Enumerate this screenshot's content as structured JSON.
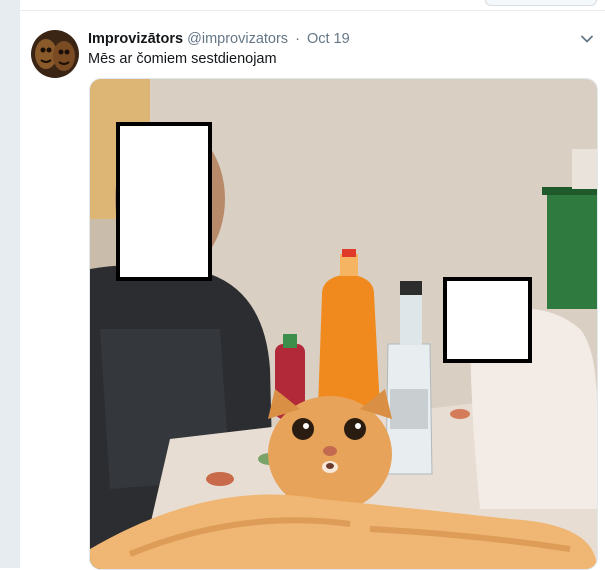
{
  "tweet": {
    "display_name": "Improvizātors",
    "handle": "@improvizators",
    "separator": "·",
    "timestamp": "Oct 19",
    "text": "Mēs ar čomiem sestdienojam"
  },
  "icons": {
    "avatar": "avatar-image",
    "more": "chevron-down-icon"
  },
  "media": {
    "description_icon": "photo"
  },
  "colors": {
    "name": "#14171a",
    "meta": "#657786",
    "gutter": "#e6ecf0"
  }
}
